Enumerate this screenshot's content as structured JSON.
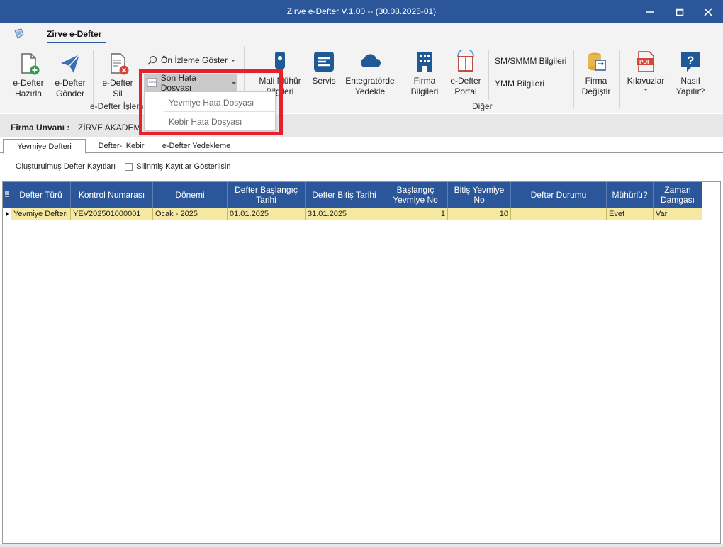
{
  "window": {
    "title": "Zirve e-Defter V.1.00  -- (30.08.2025-01)",
    "minimize_glyph": "—",
    "maximize_glyph": "☐",
    "close_glyph": "✕"
  },
  "ribbon": {
    "tab_label": "Zirve e-Defter",
    "buttons": {
      "hazirla": "e-Defter\nHazırla",
      "gonder": "e-Defter\nGönder",
      "sil": "e-Defter\nSil",
      "on_izleme": "Ön İzleme Göster",
      "son_hata": "Son Hata Dosyası",
      "mali_muhur": "Mali Mühür\nBilgileri",
      "servis": "Servis",
      "entegrator": "Entegratörde\nYedekle",
      "firma_bilgileri": "Firma\nBilgileri",
      "edefter_portal": "e-Defter\nPortal",
      "smmm": "SM/SMMM Bilgileri",
      "ymm": "YMM Bilgileri",
      "firma_degistir": "Firma\nDeğiştir",
      "kilavuzlar": "Kılavuzlar",
      "nasil": "Nasıl\nYapılır?"
    },
    "groups": {
      "islemleri": "e-Defter İşlem",
      "diger": "Diğer"
    }
  },
  "dropdown": {
    "items": [
      "Yevmiye Hata Dosyası",
      "Kebir Hata Dosyası"
    ]
  },
  "firma": {
    "label": "Firma Unvanı :",
    "value": "ZİRVE AKADEM"
  },
  "tabs": [
    "Yevmiye Defteri",
    "Defter-i Kebir",
    "e-Defter Yedekleme"
  ],
  "filter": {
    "title": "Oluşturulmuş Defter Kayıtları",
    "checkbox_label": "Silinmiş Kayıtlar Gösterilsin"
  },
  "grid": {
    "columns": [
      "Defter Türü",
      "Kontrol Numarası",
      "Dönemi",
      "Defter Başlangıç\nTarihi",
      "Defter Bitiş Tarihi",
      "Başlangıç\nYevmiye No",
      "Bitiş Yevmiye\nNo",
      "Defter Durumu",
      "Mühürlü?",
      "Zaman\nDamgası"
    ],
    "rows": [
      [
        "Yevmiye Defteri",
        "YEV202501000001",
        "Ocak - 2025",
        "01.01.2025",
        "31.01.2025",
        "1",
        "10",
        "",
        "Evet",
        "Var"
      ]
    ]
  },
  "colors": {
    "titlebar": "#2b579a",
    "grid_header": "#2b579a",
    "selected_row": "#f5e8a0",
    "highlight_box": "#e8202a"
  }
}
